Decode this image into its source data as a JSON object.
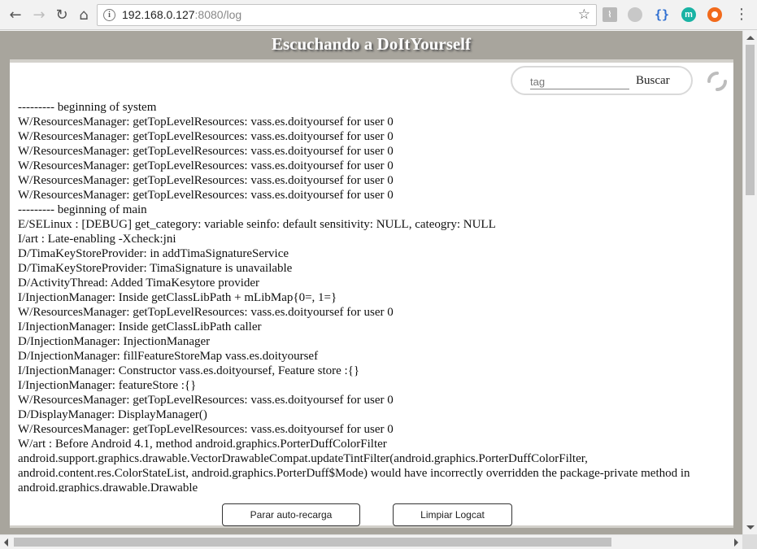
{
  "browser": {
    "url_host": "192.168.0.127",
    "url_rest": ":8080/log",
    "extensions": [
      "pdf-icon",
      "globe-icon",
      "brackets-icon",
      "m-extension-icon",
      "lifebuoy-icon"
    ]
  },
  "page": {
    "title": "Escuchando a DoItYourself",
    "search": {
      "placeholder": "tag",
      "button_label": "Buscar"
    },
    "buttons": {
      "reload": "Parar auto-recarga",
      "clear": "Limpiar Logcat"
    },
    "background_color": "#a8a59d"
  },
  "log_lines": [
    "--------- beginning of system",
    "W/ResourcesManager: getTopLevelResources: vass.es.doityoursef for user 0",
    "W/ResourcesManager: getTopLevelResources: vass.es.doityoursef for user 0",
    "W/ResourcesManager: getTopLevelResources: vass.es.doityoursef for user 0",
    "W/ResourcesManager: getTopLevelResources: vass.es.doityoursef for user 0",
    "W/ResourcesManager: getTopLevelResources: vass.es.doityoursef for user 0",
    "W/ResourcesManager: getTopLevelResources: vass.es.doityoursef for user 0",
    "--------- beginning of main",
    "E/SELinux : [DEBUG] get_category: variable seinfo: default sensitivity: NULL, cateogry: NULL",
    "I/art : Late-enabling -Xcheck:jni",
    "D/TimaKeyStoreProvider: in addTimaSignatureService",
    "D/TimaKeyStoreProvider: TimaSignature is unavailable",
    "D/ActivityThread: Added TimaKesytore provider",
    "I/InjectionManager: Inside getClassLibPath + mLibMap{0=, 1=}",
    "W/ResourcesManager: getTopLevelResources: vass.es.doityoursef for user 0",
    "I/InjectionManager: Inside getClassLibPath caller",
    "D/InjectionManager: InjectionManager",
    "D/InjectionManager: fillFeatureStoreMap vass.es.doityoursef",
    "I/InjectionManager: Constructor vass.es.doityoursef, Feature store :{}",
    "I/InjectionManager: featureStore :{}",
    "W/ResourcesManager: getTopLevelResources: vass.es.doityoursef for user 0",
    "D/DisplayManager: DisplayManager()",
    "W/ResourcesManager: getTopLevelResources: vass.es.doityoursef for user 0",
    "W/art : Before Android 4.1, method android.graphics.PorterDuffColorFilter android.support.graphics.drawable.VectorDrawableCompat.updateTintFilter(android.graphics.PorterDuffColorFilter, android.content.res.ColorStateList, android.graphics.PorterDuff$Mode) would have incorrectly overridden the package-private method in android.graphics.drawable.Drawable"
  ]
}
